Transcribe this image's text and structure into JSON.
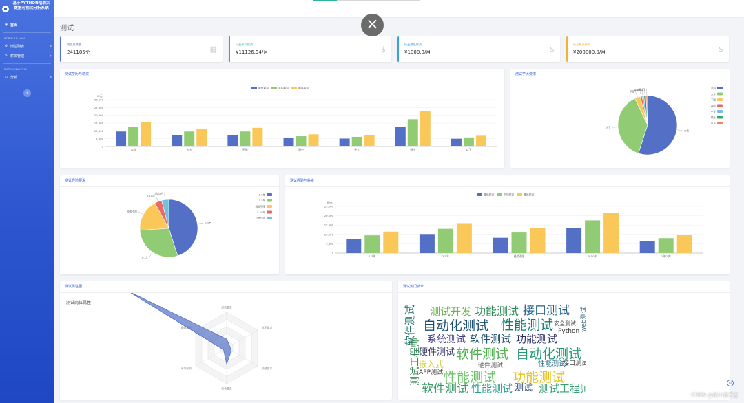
{
  "sidebar": {
    "brand": "基于PYTHON招聘大数据可视化分析系统",
    "home": "首页",
    "section1": "POPULAR JOBS",
    "jobs": "岗位列表",
    "salary": "薪资管理",
    "section2": "DATA ANALYSIS",
    "analysis": "分析",
    "toggle": "‹"
  },
  "close_icon": "×",
  "page_title": "测试",
  "stats": [
    {
      "label": "岗位总数量",
      "value": "241105个",
      "icon": "table-icon",
      "color": "#4e72d8"
    },
    {
      "label": "行业平均薪资",
      "value": "¥11126.94/月",
      "icon": "dollar-icon",
      "color": "#2fb39a"
    },
    {
      "label": "行业最低薪资",
      "value": "¥1000.0/月",
      "icon": "dollar-icon",
      "color": "#36a3d9"
    },
    {
      "label": "行业最高薪资",
      "value": "¥200000.0/月",
      "icon": "dollar-icon",
      "color": "#f2b232"
    }
  ],
  "panels": {
    "edu_salary": "测试学历与薪资",
    "edu_demand": "测试学历要求",
    "exp_demand": "测试经验要求",
    "exp_salary": "测试经验与薪资",
    "attributes": "测试属性图",
    "tech": "测试热门技术"
  },
  "radar": {
    "title": "测试岗位属性",
    "indicators": [
      "经验要求",
      "学历要求",
      "技能要求",
      "综合要求",
      "平均薪资",
      "最高薪资"
    ],
    "values": [
      0.25,
      0.1,
      0.15,
      0.45,
      0.1,
      3.2
    ]
  },
  "chart_data": [
    {
      "type": "bar",
      "title": "测试学历与薪资",
      "ylabel": "K/元",
      "ylim": [
        0,
        30000
      ],
      "yticks": [
        "0",
        "5,000",
        "10,000",
        "15,000",
        "20,000",
        "25,000",
        "30,000"
      ],
      "legend": "top-center",
      "categories": [
        "本科",
        "大专",
        "不限",
        "高中",
        "中专",
        "硕士",
        "以下"
      ],
      "series": [
        {
          "name": "最低薪资",
          "color": "#5470c6",
          "values": [
            9600,
            7500,
            7400,
            5500,
            5100,
            12500,
            5000
          ]
        },
        {
          "name": "平均薪资",
          "color": "#91cc75",
          "values": [
            12500,
            9600,
            9600,
            6600,
            6200,
            17500,
            5800
          ]
        },
        {
          "name": "最高薪资",
          "color": "#fac858",
          "values": [
            15500,
            11500,
            12000,
            7800,
            7400,
            22500,
            6900
          ]
        }
      ]
    },
    {
      "type": "pie",
      "title": "测试学历要求",
      "legend": "right",
      "slices": [
        {
          "name": "本科",
          "value": 55,
          "color": "#5470c6"
        },
        {
          "name": "大专",
          "value": 38,
          "color": "#91cc75"
        },
        {
          "name": "不限",
          "value": 3,
          "color": "#fac858"
        },
        {
          "name": "高中",
          "value": 1,
          "color": "#ee6666"
        },
        {
          "name": "中专",
          "value": 1,
          "color": "#73c0de"
        },
        {
          "name": "硕士",
          "value": 1.2,
          "color": "#3ba272"
        },
        {
          "name": "以下",
          "value": 0.8,
          "color": "#fc8452"
        }
      ]
    },
    {
      "type": "pie",
      "title": "测试经验要求",
      "legend": "right",
      "slices": [
        {
          "name": "1-3年",
          "value": 45,
          "color": "#5470c6"
        },
        {
          "name": "3-5年",
          "value": 29,
          "color": "#91cc75"
        },
        {
          "name": "经验不限",
          "value": 18,
          "color": "#fac858"
        },
        {
          "name": "5-10年",
          "value": 4,
          "color": "#ee6666"
        },
        {
          "name": "1年以内",
          "value": 4,
          "color": "#73c0de"
        }
      ]
    },
    {
      "type": "bar",
      "title": "测试经验与薪资",
      "ylabel": "K/元",
      "ylim": [
        0,
        25000
      ],
      "yticks": [
        "0",
        "5,000",
        "10,000",
        "15,000",
        "20,000",
        "25,000"
      ],
      "legend": "top-center",
      "categories": [
        "1-3年",
        "3-5年",
        "经验不限",
        "5-10年",
        "1年以内"
      ],
      "series": [
        {
          "name": "最低薪资",
          "color": "#5470c6",
          "values": [
            7400,
            10200,
            8200,
            13500,
            6300
          ]
        },
        {
          "name": "平均薪资",
          "color": "#91cc75",
          "values": [
            9500,
            13000,
            11000,
            17500,
            8000
          ]
        },
        {
          "name": "最高薪资",
          "color": "#fac858",
          "values": [
            11500,
            16000,
            13500,
            21500,
            9800
          ]
        }
      ]
    }
  ],
  "wordcloud": [
    {
      "t": "功能测试",
      "x": 105,
      "y": 12,
      "s": 16,
      "c": "#2e8b57"
    },
    {
      "t": "接口测试",
      "x": 175,
      "y": 11,
      "s": 17,
      "c": "#1d5c8a"
    },
    {
      "t": "测试开发",
      "x": 40,
      "y": 13,
      "s": 15,
      "c": "#6ab04c"
    },
    {
      "t": "软件测试",
      "x": 4,
      "y": 70,
      "s": 15,
      "c": "#2c7873",
      "v": true
    },
    {
      "t": "自动化测试",
      "x": 30,
      "y": 32,
      "s": 19,
      "c": "#1b4f72"
    },
    {
      "t": "性能测试",
      "x": 143,
      "y": 31,
      "s": 19,
      "c": "#147a6f"
    },
    {
      "t": "安全测试",
      "x": 220,
      "y": 34,
      "s": 8,
      "c": "#444"
    },
    {
      "t": "Python",
      "x": 226,
      "y": 45,
      "s": 9,
      "c": "#333"
    },
    {
      "t": "系统测试",
      "x": 36,
      "y": 54,
      "s": 14,
      "c": "#3f3d8a"
    },
    {
      "t": "软件测试",
      "x": 98,
      "y": 53,
      "s": 15,
      "c": "#1e4d6b"
    },
    {
      "t": "功能测试",
      "x": 165,
      "y": 53,
      "s": 15,
      "c": "#2b2b6b"
    },
    {
      "t": "硬件测试",
      "x": 24,
      "y": 73,
      "s": 13,
      "c": "#333366"
    },
    {
      "t": "软件测试",
      "x": 78,
      "y": 73,
      "s": 19,
      "c": "#4bb04b"
    },
    {
      "t": "自动化测试",
      "x": 165,
      "y": 73,
      "s": 19,
      "c": "#239a75"
    },
    {
      "t": "嵌入式",
      "x": 24,
      "y": 91,
      "s": 12,
      "c": "#c8d12c"
    },
    {
      "t": "硬件测试",
      "x": 110,
      "y": 95,
      "s": 9,
      "c": "#555"
    },
    {
      "t": "性能测试",
      "x": 197,
      "y": 92,
      "s": 10,
      "c": "#2b6b8a"
    },
    {
      "t": "接口测试",
      "x": 233,
      "y": 92,
      "s": 9,
      "c": "#444"
    },
    {
      "t": "APP测试",
      "x": 24,
      "y": 105,
      "s": 9,
      "c": "#333"
    },
    {
      "t": "测试工程师",
      "x": 12,
      "y": 128,
      "s": 14,
      "c": "#3b8a5a",
      "v": true
    },
    {
      "t": "性能测试",
      "x": 60,
      "y": 107,
      "s": 19,
      "c": "#6fc26a"
    },
    {
      "t": "功能测试",
      "x": 160,
      "y": 107,
      "s": 19,
      "c": "#e6c21a"
    },
    {
      "t": "软件测试",
      "x": 28,
      "y": 125,
      "s": 17,
      "c": "#3f9c6a"
    },
    {
      "t": "性能测试",
      "x": 100,
      "y": 125,
      "s": 15,
      "c": "#2a9d8f"
    },
    {
      "t": "测试",
      "x": 163,
      "y": 125,
      "s": 13,
      "c": "#1d3d6b"
    },
    {
      "t": "测试工程师",
      "x": 198,
      "y": 125,
      "s": 15,
      "c": "#34a070"
    },
    {
      "t": "web测试",
      "x": 260,
      "y": 50,
      "s": 9,
      "c": "#3b6b8a",
      "v": true
    }
  ],
  "watermark": "CSDN @星川智无恋",
  "mini_icon": "AI"
}
